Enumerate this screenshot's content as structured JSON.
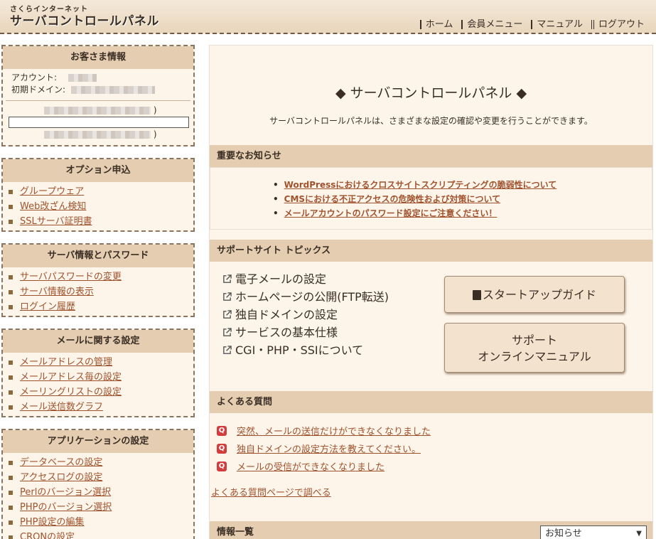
{
  "header": {
    "brand_sub": "さくらインターネット",
    "brand_main": "サーバコントロールパネル",
    "nav": [
      "ホーム",
      "会員メニュー",
      "マニュアル",
      "ログアウト"
    ]
  },
  "sidebar": {
    "customer": {
      "title": "お客さま情報",
      "account_label": "アカウント:",
      "domain_label": "初期ドメイン:"
    },
    "sections": [
      {
        "title": "オプション申込",
        "items": [
          "グループウェア",
          "Web改ざん検知",
          "SSLサーバ証明書"
        ]
      },
      {
        "title": "サーバ情報とパスワード",
        "items": [
          "サーバパスワードの変更",
          "サーバ情報の表示",
          "ログイン履歴"
        ]
      },
      {
        "title": "メールに関する設定",
        "items": [
          "メールアドレスの管理",
          "メールアドレス毎の設定",
          "メーリングリストの設定",
          "メール送信数グラフ"
        ]
      },
      {
        "title": "アプリケーションの設定",
        "items": [
          "データベースの設定",
          "アクセスログの設定",
          "Perlのバージョン選択",
          "PHPのバージョン選択",
          "PHP設定の編集",
          "CRONの設定"
        ]
      }
    ]
  },
  "main": {
    "title": "◆ サーバコントロールパネル ◆",
    "description": "サーバコントロールパネルは、さまざまな設定の確認や変更を行うことができます。",
    "notice": {
      "heading": "重要なお知らせ",
      "items": [
        "WordPressにおけるクロスサイトスクリプティングの脆弱性について",
        "CMSにおける不正アクセスの危険性および対策について",
        "メールアカウントのパスワード設定にご注意ください！"
      ]
    },
    "topics": {
      "heading": "サポートサイト トピックス",
      "links": [
        "電子メールの設定",
        "ホームページの公開(FTP転送)",
        "独自ドメインの設定",
        "サービスの基本仕様",
        "CGI・PHP・SSIについて"
      ],
      "startup_button": "スタートアップガイド",
      "manual_button_line1": "サポート",
      "manual_button_line2": "オンラインマニュアル"
    },
    "faq": {
      "heading": "よくある質問",
      "items": [
        "突然、メールの送信だけができなくなりました",
        "独自ドメインの設定方法を教えてください。",
        "メールの受信ができなくなりました"
      ],
      "more_link": "よくある質問ページで調べる",
      "icon_letter": "Q"
    },
    "info": {
      "heading": "情報一覧",
      "select_value": "お知らせ"
    }
  },
  "colors": {
    "accent": "#a0522d",
    "section_bg": "#e5cdb1",
    "panel_bg": "#fdf5ea"
  }
}
